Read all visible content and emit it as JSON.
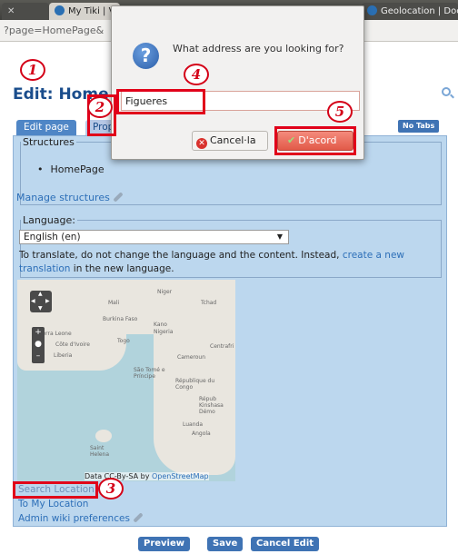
{
  "browser": {
    "tabs": [
      {
        "label": "My Tiki | Vi"
      },
      {
        "label": "Geolocation | Docu"
      }
    ],
    "url": "?page=HomePage&"
  },
  "page": {
    "title": "Edit: Home",
    "tabs": {
      "edit": "Edit page",
      "properties": "Properties"
    },
    "no_tabs": "No Tabs",
    "structures": {
      "legend": "Structures",
      "items": [
        "HomePage"
      ],
      "manage": "Manage structures"
    },
    "language": {
      "legend": "Language:",
      "selected": "English (en)",
      "note_before": "To translate, do not change the language and the content. Instead, ",
      "note_link1": "create a new",
      "note_link2": "translation",
      "note_after": " in the new language."
    },
    "map": {
      "attribution_prefix": "Data CC-By-SA by ",
      "attribution_link": "OpenStreetMap",
      "labels": [
        "Mali",
        "Niger",
        "Tchad",
        "Burkina Faso",
        "Kano",
        "Nigeria",
        "Sierra Leone",
        "Côte d'Ivoire",
        "Togo",
        "Liberia",
        "Cameroun",
        "Centrafri",
        "São Tomé e Príncipe",
        "République du Congo",
        "Répub Kinshasa Démo",
        "Luanda",
        "Angola",
        "Saint Helena"
      ]
    },
    "links": {
      "search_location": "Search Location",
      "to_my_location": "To My Location",
      "admin_prefs": "Admin wiki preferences"
    },
    "buttons": {
      "preview": "Preview",
      "save": "Save",
      "cancel_edit": "Cancel Edit"
    }
  },
  "dialog": {
    "question": "What address are you looking for?",
    "input_value": "Figueres",
    "cancel_label": "Cancel·la",
    "ok_label": "D'acord"
  },
  "annotations": [
    "1",
    "2",
    "3",
    "4",
    "5"
  ],
  "colors": {
    "highlight": "#e1001a",
    "link": "#2d6fb8",
    "title": "#1a4d8c"
  }
}
